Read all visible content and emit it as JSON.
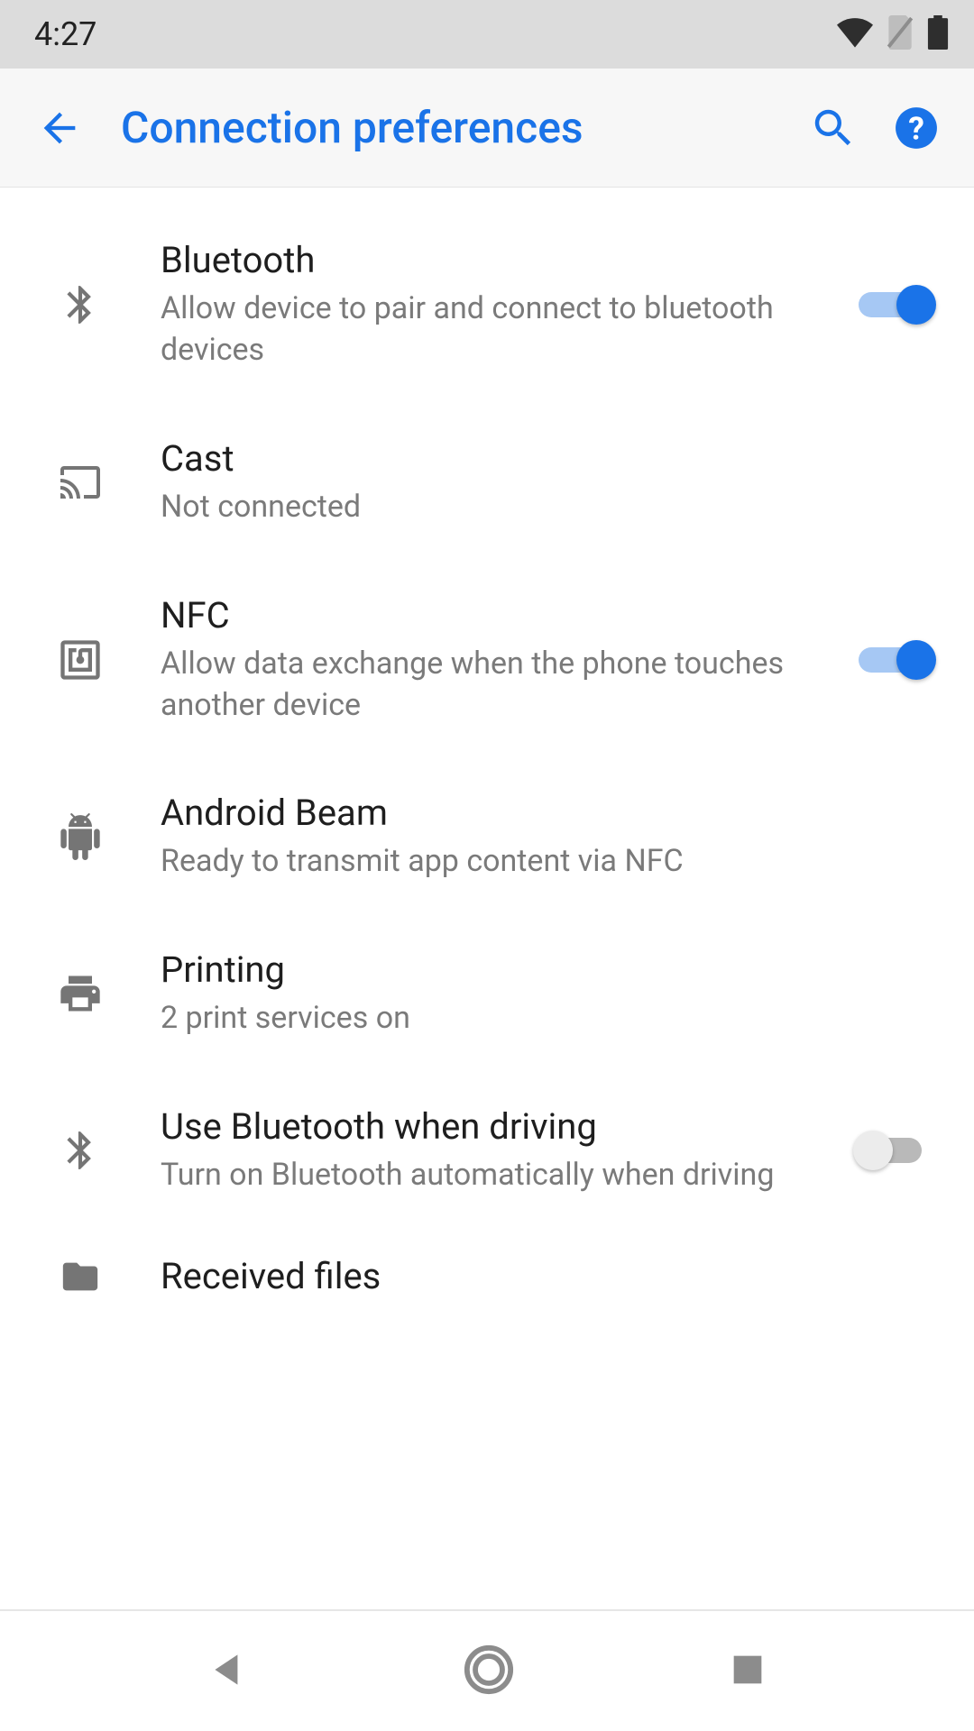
{
  "status": {
    "time": "4:27"
  },
  "header": {
    "title": "Connection preferences"
  },
  "items": {
    "bluetooth": {
      "title": "Bluetooth",
      "sub": "Allow device to pair and connect to bluetooth devices",
      "on": true
    },
    "cast": {
      "title": "Cast",
      "sub": "Not connected"
    },
    "nfc": {
      "title": "NFC",
      "sub": "Allow data exchange when the phone touches another device",
      "on": true
    },
    "beam": {
      "title": "Android Beam",
      "sub": "Ready to transmit app content via NFC"
    },
    "printing": {
      "title": "Printing",
      "sub": "2 print services on"
    },
    "bt_driving": {
      "title": "Use Bluetooth when driving",
      "sub": "Turn on Bluetooth automatically when driving",
      "on": false
    },
    "received": {
      "title": "Received files"
    }
  }
}
